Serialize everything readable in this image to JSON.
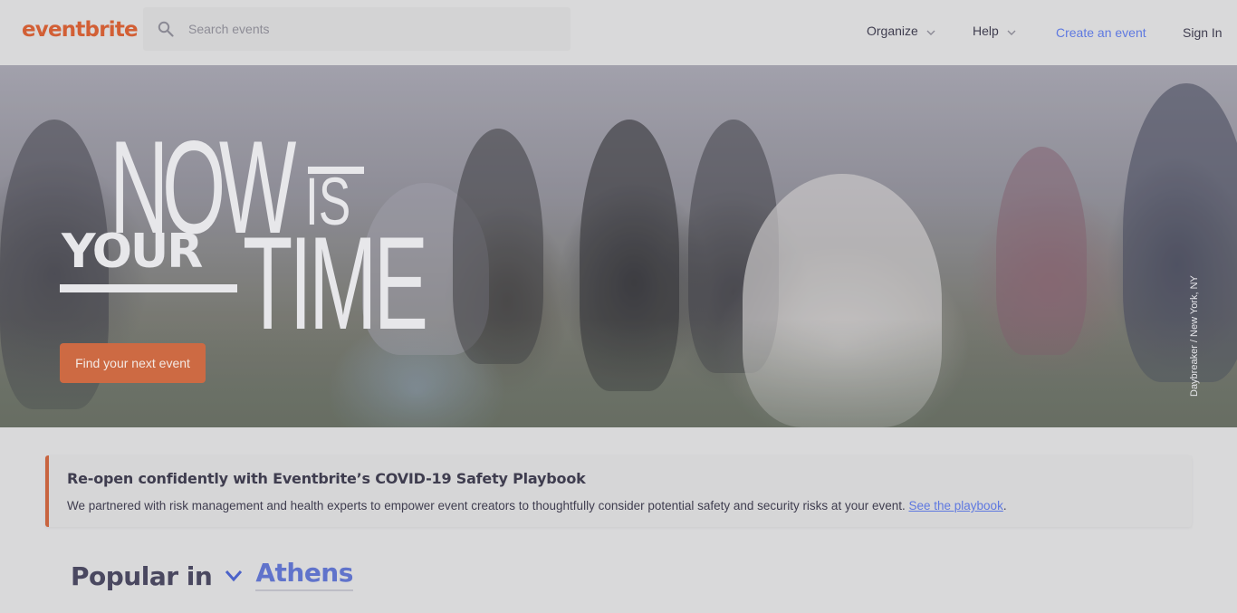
{
  "header": {
    "logo": "eventbrite",
    "search": {
      "placeholder": "Search events",
      "value": ""
    },
    "nav": {
      "organize": "Organize",
      "help": "Help",
      "create_event": "Create an event",
      "sign_in": "Sign In"
    }
  },
  "hero": {
    "title_now": "NOW",
    "title_is": "IS",
    "title_your": "YOUR",
    "title_time": "TIME",
    "cta_label": "Find your next event",
    "photo_credit": "Daybreaker / New York, NY"
  },
  "banner": {
    "title": "Re-open confidently with Eventbrite’s COVID-19 Safety Playbook",
    "text": "We partnered with risk management and health experts to empower event creators to thoughtfully consider potential safety and security risks at your event. ",
    "link_label": "See the playbook",
    "trailing": "."
  },
  "popular": {
    "label": "Popular in",
    "city": "Athens"
  },
  "colors": {
    "brand": "#d1410c",
    "link": "#3659e3",
    "cta": "#cd6a43"
  }
}
